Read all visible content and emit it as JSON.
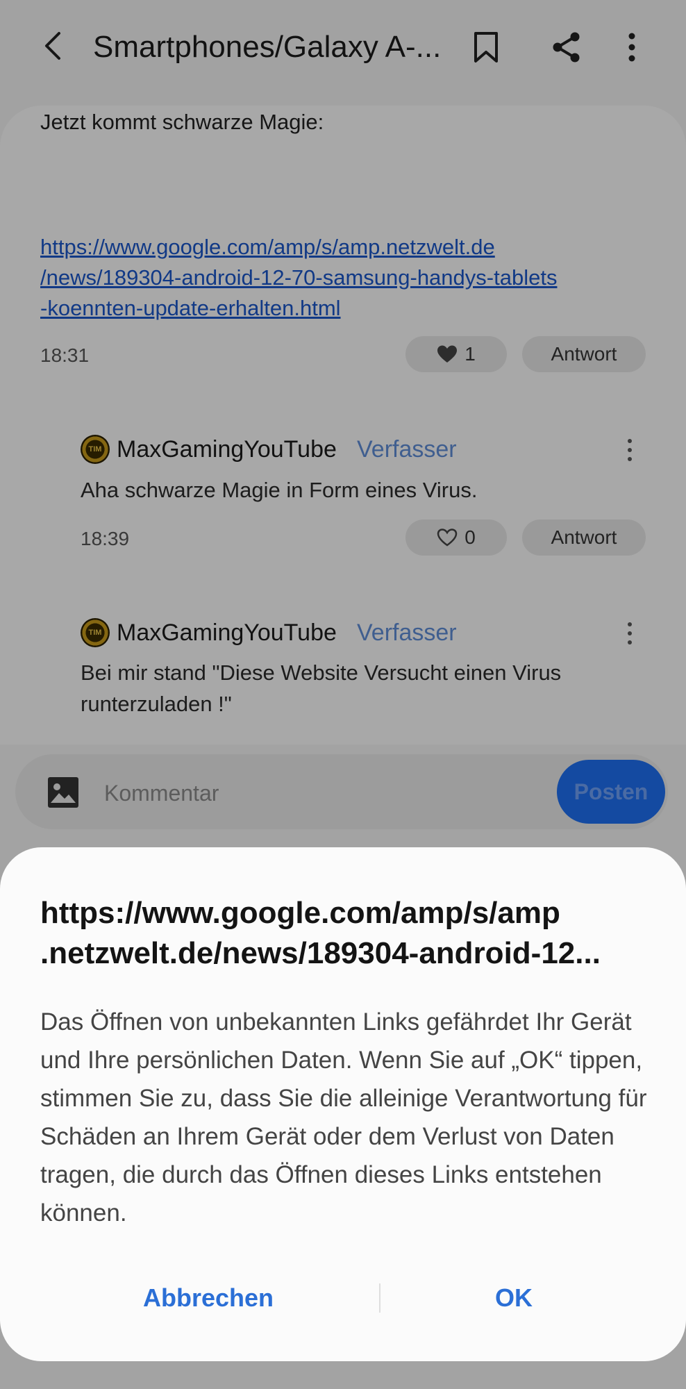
{
  "appbar": {
    "title": "Smartphones/Galaxy A-...",
    "back_icon": "back-arrow-icon",
    "bookmark_icon": "bookmark-icon",
    "share_icon": "share-icon",
    "more_icon": "more-vert-icon"
  },
  "post": {
    "text": "Jetzt kommt schwarze Magie:",
    "link_lines": [
      "https://www.google.com/amp/s/amp.netzwelt.de",
      "/news/189304-android-12-70-samsung-handys-tablets",
      "-koennten-update-erhalten.html"
    ],
    "time": "18:31",
    "likes": "1",
    "reply_label": "Antwort"
  },
  "comments": [
    {
      "avatar_text": "TIM",
      "username": "MaxGamingYouTube",
      "badge": "Verfasser",
      "text": "Aha schwarze Magie in Form eines Virus.",
      "time": "18:39",
      "likes": "0",
      "reply_label": "Antwort"
    },
    {
      "avatar_text": "TIM",
      "username": "MaxGamingYouTube",
      "badge": "Verfasser",
      "text": "Bei mir stand \"Diese Website Versucht einen Virus runterzuladen !\""
    }
  ],
  "composer": {
    "placeholder": "Kommentar",
    "post_label": "Posten",
    "image_icon": "image-icon"
  },
  "dialog": {
    "title_line1": "https://www.google.com/amp/s/amp",
    "title_line2": ".netzwelt.de/news/189304-android-12...",
    "body": "Das Öffnen von unbekannten Links gefährdet Ihr Gerät und Ihre persönlichen Daten. Wenn Sie auf „OK“ tippen, stimmen Sie zu, dass Sie die alleinige Verantwortung für Schäden an Ihrem Gerät oder dem Verlust von Daten tragen, die durch das Öffnen dieses Links entstehen können.",
    "cancel_label": "Abbrechen",
    "ok_label": "OK"
  },
  "colors": {
    "accent": "#2b6fd6",
    "link": "#1a56c8",
    "badge": "#5f8cd6",
    "post_button": "#1e6ff0"
  }
}
